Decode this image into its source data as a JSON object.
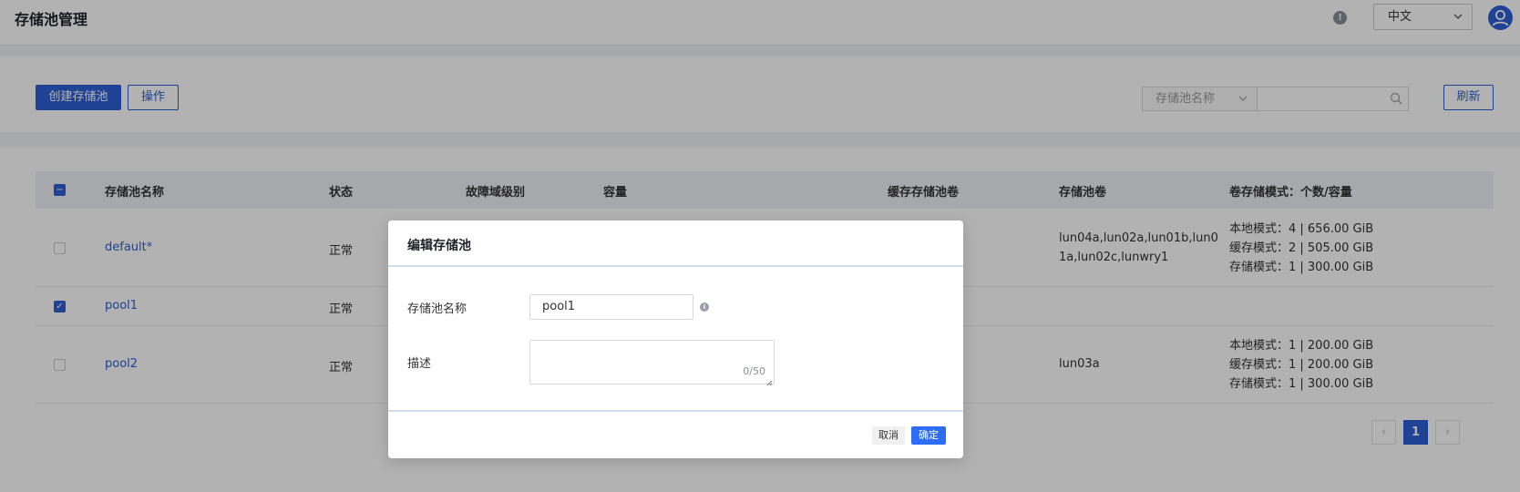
{
  "header": {
    "title": "存储池管理",
    "language": "中文"
  },
  "toolbar": {
    "create_label": "创建存储池",
    "ops_label": "操作",
    "filter_field": "存储池名称",
    "search_value": "",
    "refresh_label": "刷新"
  },
  "table": {
    "headers": {
      "name": "存储池名称",
      "status": "状态",
      "fault_domain": "故障域级别",
      "capacity": "容量",
      "cache_volume": "缓存存储池卷",
      "volumes": "存储池卷",
      "mode": "卷存储模式：个数/容量"
    },
    "rows": [
      {
        "name": "default*",
        "status": "正常",
        "checked": false,
        "volumes": "lun04a,lun02a,lun01b,lun0\n1a,lun02c,lunwry1",
        "mode": "本地模式：4 | 656.00 GiB\n缓存模式：2 | 505.00 GiB\n存储模式：1 | 300.00 GiB"
      },
      {
        "name": "pool1",
        "status": "正常",
        "checked": true,
        "volumes": "",
        "mode": ""
      },
      {
        "name": "pool2",
        "status": "正常",
        "checked": false,
        "volumes": "lun03a",
        "mode": "本地模式：1 | 200.00 GiB\n缓存模式：1 | 200.00 GiB\n存储模式：1 | 300.00 GiB"
      }
    ]
  },
  "pagination": {
    "prev": "‹",
    "current": "1",
    "next": "›"
  },
  "dialog": {
    "title": "编辑存储池",
    "name_label": "存储池名称",
    "name_value": "pool1",
    "desc_label": "描述",
    "desc_value": "",
    "desc_counter": "0/50",
    "cancel_label": "取消",
    "ok_label": "确定"
  },
  "colors": {
    "primary": "#2d5fd6",
    "dialog_ok": "#2d6cf5"
  }
}
